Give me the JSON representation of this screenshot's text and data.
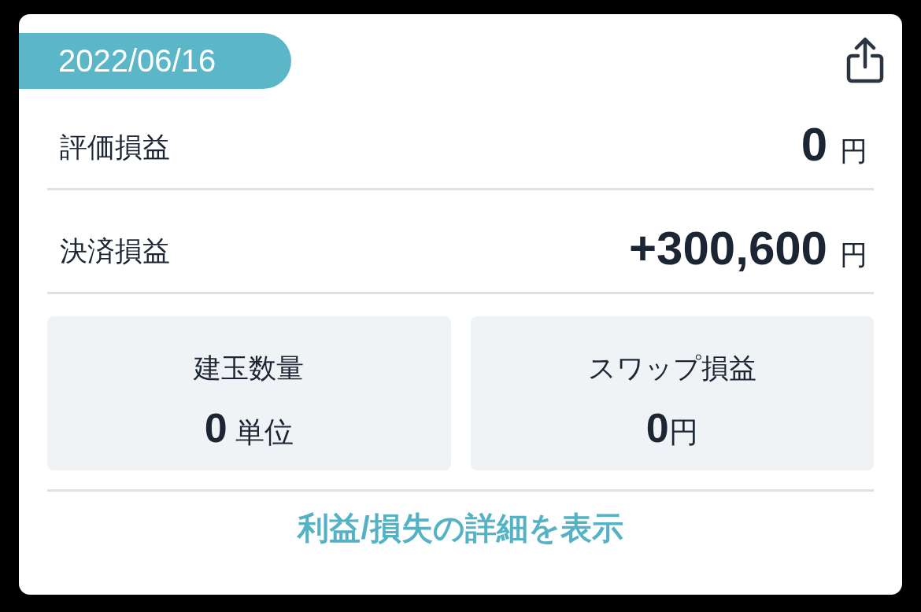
{
  "date": "2022/06/16",
  "rows": [
    {
      "label": "評価損益",
      "value": "0",
      "unit": "円"
    },
    {
      "label": "決済損益",
      "value": "+300,600",
      "unit": "円"
    }
  ],
  "tiles": [
    {
      "label": "建玉数量",
      "value": "0",
      "unit": "単位"
    },
    {
      "label": "スワップ損益",
      "value": "0",
      "unit": "円"
    }
  ],
  "details_link": "利益/損失の詳細を表示"
}
